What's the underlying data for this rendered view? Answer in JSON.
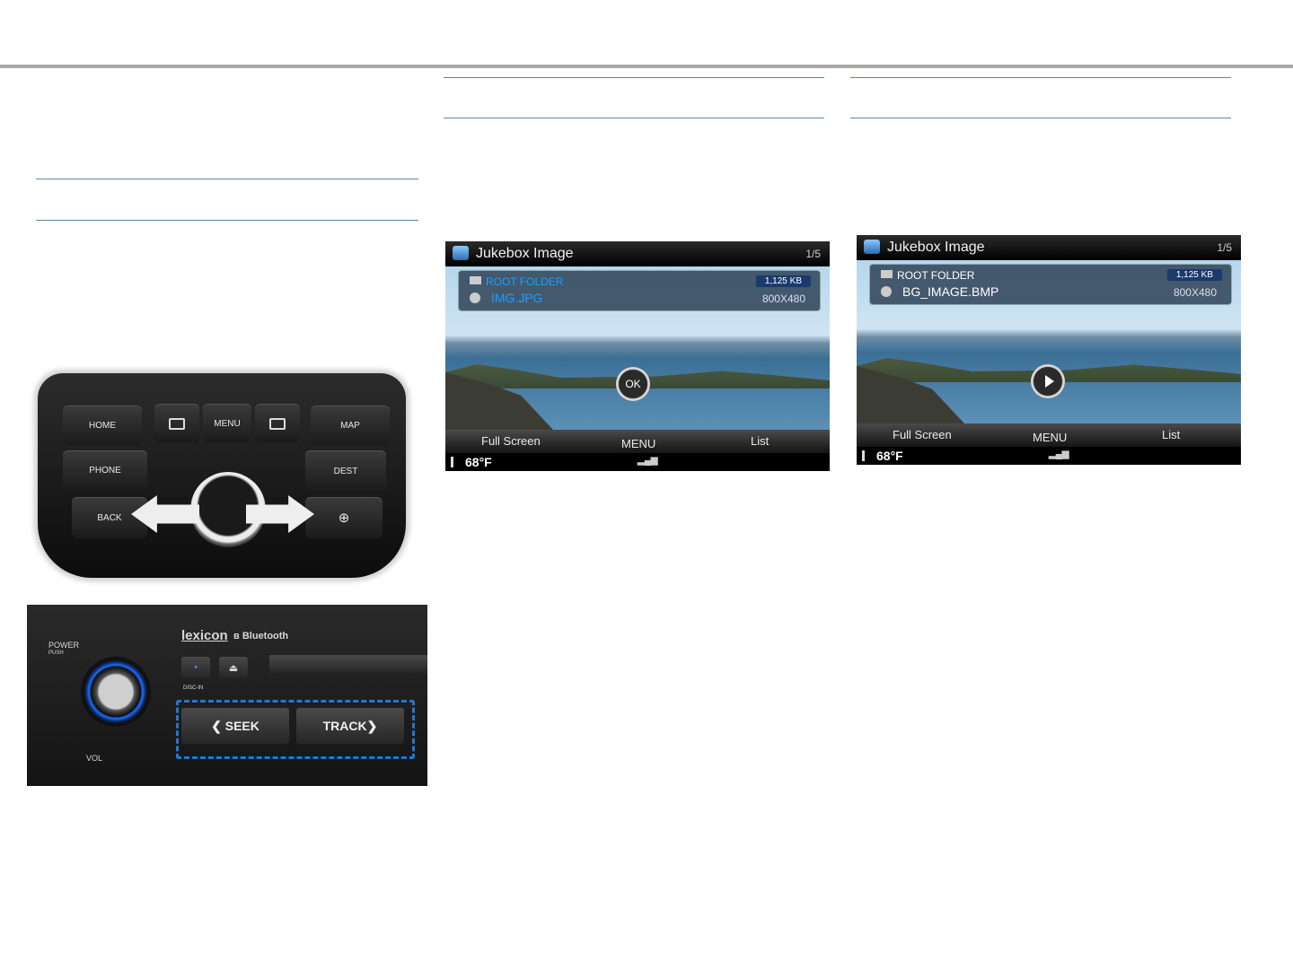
{
  "controller": {
    "home": "HOME",
    "menu": "MENU",
    "map": "MAP",
    "phone": "PHONE",
    "dest": "DEST",
    "back": "BACK"
  },
  "head_unit": {
    "power": "POWER",
    "push": "PUSH",
    "vol": "VOL",
    "brand": "lexicon",
    "bluetooth": "Bluetooth",
    "disc_in": "DISC-IN",
    "seek": "❮ SEEK",
    "track": "TRACK❯"
  },
  "screens": [
    {
      "title": "Jukebox Image",
      "page": "1/5",
      "folder": "ROOT FOLDER",
      "file": "IMG.JPG",
      "size": "1,125 KB",
      "resolution": "800X480",
      "center_button": "OK",
      "tabs": [
        "Full Screen",
        "MENU",
        "List"
      ],
      "temperature": "68°F",
      "accent_color": "#1aa0ff"
    },
    {
      "title": "Jukebox Image",
      "page": "1/5",
      "folder": "ROOT FOLDER",
      "file": "BG_IMAGE.BMP",
      "size": "1,125 KB",
      "resolution": "800X480",
      "center_button": "play-icon",
      "tabs": [
        "Full Screen",
        "MENU",
        "List"
      ],
      "temperature": "68°F",
      "accent_color": "#ffffff"
    }
  ]
}
